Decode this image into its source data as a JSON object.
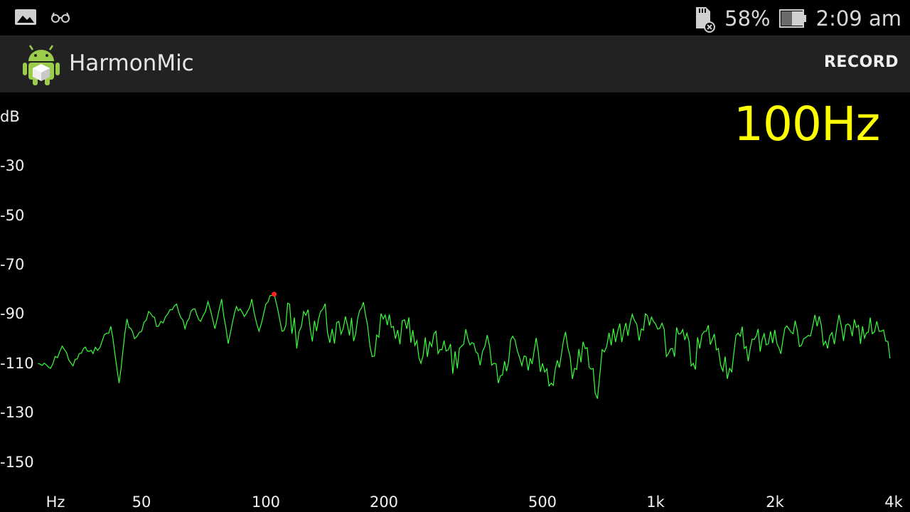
{
  "status_bar": {
    "battery": "58%",
    "time": "2:09 am"
  },
  "action_bar": {
    "title": "HarmonMic",
    "record_label": "RECORD"
  },
  "readout": {
    "frequency": "100Hz"
  },
  "colors": {
    "trace": "#39ff3a",
    "peak_marker": "#ff2020",
    "readout": "#ffff00",
    "action_bar_bg": "#222222"
  },
  "chart_data": {
    "type": "line",
    "xlabel": "Hz",
    "ylabel": "dB",
    "x_scale": "log",
    "xlim": [
      26,
      4000
    ],
    "ylim": [
      -160,
      -10
    ],
    "yticks": [
      "-30",
      "-50",
      "-70",
      "-90",
      "-110",
      "-130",
      "-150"
    ],
    "xticks": [
      "50",
      "100",
      "200",
      "500",
      "1k",
      "2k",
      "4k"
    ],
    "peak": {
      "x": 105,
      "y": -82
    },
    "series": [
      {
        "x": [
          26,
          28,
          30,
          32,
          34,
          36,
          38,
          40,
          42,
          44,
          46,
          48,
          50,
          53,
          56,
          59,
          62,
          65,
          68,
          71,
          74,
          77,
          80,
          84,
          88,
          92,
          96,
          100,
          105,
          110,
          115,
          120,
          125,
          130,
          140,
          150,
          160,
          170,
          180,
          190,
          200,
          215,
          230,
          250,
          270,
          290,
          310,
          330,
          350,
          375,
          400,
          430,
          460,
          500,
          540,
          580,
          620,
          660,
          700,
          750,
          800,
          860,
          920,
          1000,
          1080,
          1160,
          1250,
          1350,
          1450,
          1550,
          1650,
          1750,
          1900,
          2050,
          2200,
          2400,
          2600,
          2800,
          3000,
          3200,
          3400,
          3600,
          3800,
          3900,
          4000
        ],
        "y": [
          -110,
          -112,
          -103,
          -111,
          -104,
          -106,
          -101,
          -95,
          -118,
          -92,
          -100,
          -97,
          -89,
          -95,
          -90,
          -86,
          -96,
          -88,
          -93,
          -85,
          -96,
          -84,
          -102,
          -87,
          -91,
          -84,
          -97,
          -86,
          -82,
          -97,
          -86,
          -104,
          -89,
          -96,
          -88,
          -102,
          -91,
          -98,
          -90,
          -107,
          -92,
          -100,
          -96,
          -110,
          -98,
          -105,
          -112,
          -100,
          -106,
          -103,
          -115,
          -99,
          -107,
          -105,
          -118,
          -101,
          -112,
          -104,
          -122,
          -103,
          -97,
          -94,
          -96,
          -94,
          -106,
          -98,
          -110,
          -97,
          -104,
          -112,
          -99,
          -104,
          -98,
          -102,
          -96,
          -100,
          -95,
          -99,
          -95,
          -99,
          -95,
          -98,
          -97,
          -101,
          -108
        ]
      }
    ]
  }
}
